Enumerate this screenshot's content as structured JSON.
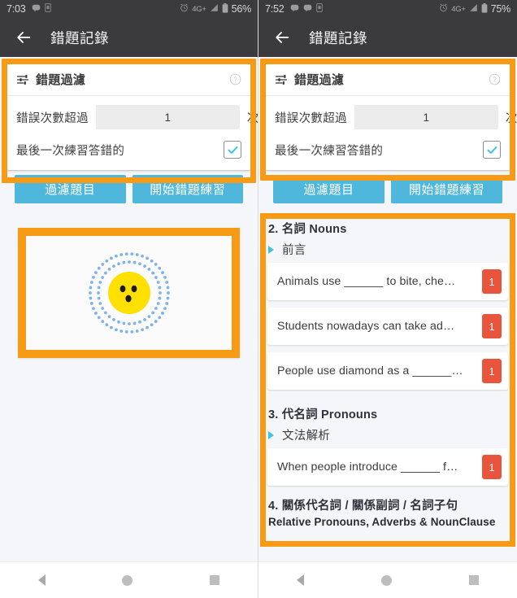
{
  "screens": [
    {
      "id": "left",
      "statusbar": {
        "clock": "7:03",
        "network": "4G+",
        "battery_pct": "56%",
        "icons": [
          "message-icon",
          "sim-icon",
          "alarm-icon",
          "signal-icon",
          "battery-icon"
        ]
      },
      "appbar": {
        "back_icon": "back-arrow-icon",
        "title": "錯題記錄"
      },
      "filter_card": {
        "icon": "tune-filter-icon",
        "title": "錯題過濾",
        "help_icon": "help-circle-icon",
        "count_label": "錯誤次數超過",
        "count_value": "1",
        "count_placeholder": "1",
        "count_suffix": "次以上",
        "checkbox_label": "最後一次練習答錯的",
        "checkbox_checked": true,
        "buttons": [
          {
            "name": "filter-questions-button",
            "label": "過濾題目"
          },
          {
            "name": "start-practice-button",
            "label": "開始錯題練習"
          }
        ]
      },
      "empty_state": {
        "illustration": "surprised-face-emoji",
        "rings": "dotted-rings"
      }
    },
    {
      "id": "right",
      "statusbar": {
        "clock": "7:52",
        "network": "4G+",
        "battery_pct": "75%",
        "icons": [
          "message-icon",
          "message-icon",
          "sim-icon",
          "alarm-icon",
          "signal-icon",
          "battery-icon"
        ]
      },
      "appbar": {
        "back_icon": "back-arrow-icon",
        "title": "錯題記錄"
      },
      "filter_card": {
        "icon": "tune-filter-icon",
        "title": "錯題過濾",
        "help_icon": "help-circle-icon",
        "count_label": "錯誤次數超過",
        "count_value": "1",
        "count_placeholder": "1",
        "count_suffix": "次以上",
        "checkbox_label": "最後一次練習答錯的",
        "checkbox_checked": true,
        "buttons": [
          {
            "name": "filter-questions-button",
            "label": "過濾題目"
          },
          {
            "name": "start-practice-button",
            "label": "開始錯題練習"
          }
        ]
      },
      "question_list": {
        "sections": [
          {
            "heading": "2. 名詞 Nouns",
            "subheading": "前言",
            "items": [
              {
                "text": "Animals use ______ to bite, che…",
                "count": "1"
              },
              {
                "text": "Students nowadays can take ad…",
                "count": "1"
              },
              {
                "text": "People use diamond as a ______…",
                "count": "1"
              }
            ]
          },
          {
            "heading": "3. 代名詞 Pronouns",
            "subheading": "文法解析",
            "items": [
              {
                "text": "When people introduce ______ f…",
                "count": "1"
              }
            ]
          },
          {
            "heading": "4. 關係代名詞 / 關係副詞 / 名詞子句",
            "heading_en": "Relative Pronouns, Adverbs & NounClause",
            "subheading": null,
            "items": []
          }
        ]
      }
    }
  ],
  "navbar": {
    "back": "nav-back-icon",
    "home": "nav-home-icon",
    "recents": "nav-recents-icon"
  },
  "colors": {
    "highlight": "#F79B17",
    "button": "#4EB7DB",
    "badge": "#E8543C",
    "appbar": "#3b3b3d",
    "page_bg": "#F4F6FA",
    "accent_triangle": "#3FC3DC"
  }
}
